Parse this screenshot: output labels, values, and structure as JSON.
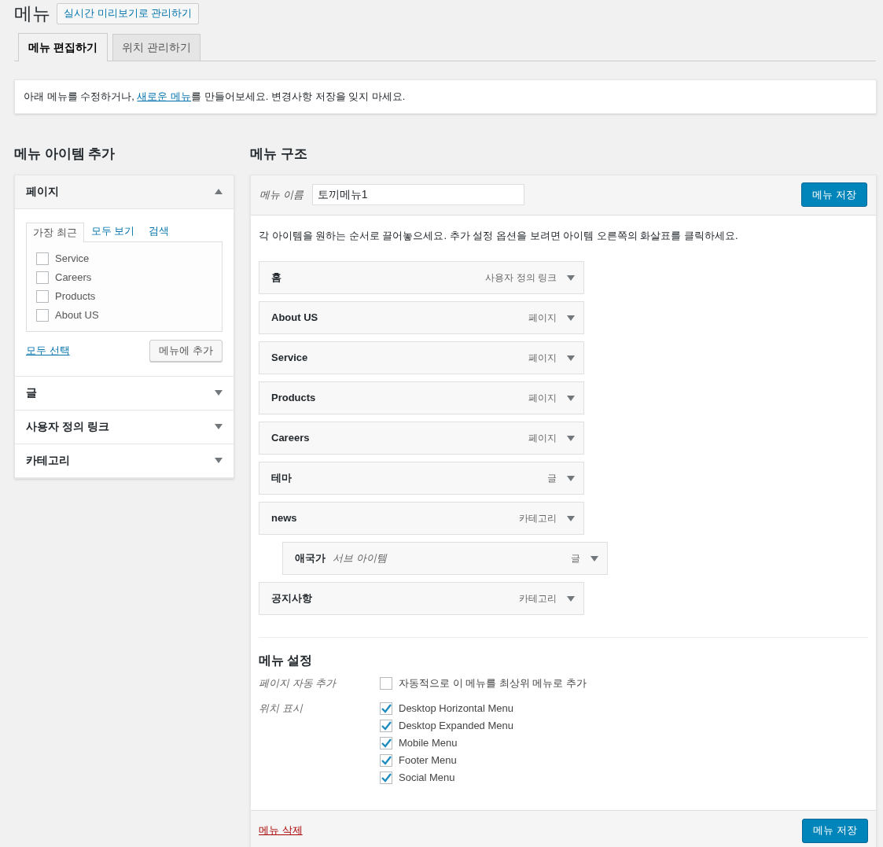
{
  "page_title": "메뉴",
  "live_preview_button": "실시간 미리보기로 관리하기",
  "tabs": [
    {
      "label": "메뉴 편집하기",
      "selected": true
    },
    {
      "label": "위치 관리하기",
      "selected": false
    }
  ],
  "notice": {
    "before": "아래 메뉴를 수정하거나, ",
    "link": "새로운 메뉴",
    "after": "를 만들어보세요. 변경사항 저장을 잊지 마세요."
  },
  "add_items": {
    "heading": "메뉴 아이템 추가",
    "sections": [
      {
        "title": "페이지",
        "expanded": true,
        "subtabs": [
          {
            "label": "가장 최근",
            "selected": true
          },
          {
            "label": "모두 보기",
            "selected": false
          },
          {
            "label": "검색",
            "selected": false
          }
        ],
        "items": [
          {
            "label": "Service",
            "checked": false
          },
          {
            "label": "Careers",
            "checked": false
          },
          {
            "label": "Products",
            "checked": false
          },
          {
            "label": "About US",
            "checked": false
          }
        ],
        "select_all": "모두 선택",
        "add_button": "메뉴에 추가"
      },
      {
        "title": "글",
        "expanded": false
      },
      {
        "title": "사용자 정의 링크",
        "expanded": false
      },
      {
        "title": "카테고리",
        "expanded": false
      }
    ]
  },
  "structure": {
    "heading": "메뉴 구조",
    "name_label": "메뉴 이름",
    "name_value": "토끼메뉴1",
    "save_button": "메뉴 저장",
    "instructions": "각 아이템을 원하는 순서로 끌어놓으세요. 추가 설정 옵션을 보려면 아이템 오른쪽의 화살표를 클릭하세요.",
    "items": [
      {
        "title": "홈",
        "type": "사용자 정의 링크"
      },
      {
        "title": "About US",
        "type": "페이지"
      },
      {
        "title": "Service",
        "type": "페이지"
      },
      {
        "title": "Products",
        "type": "페이지"
      },
      {
        "title": "Careers",
        "type": "페이지"
      },
      {
        "title": "테마",
        "type": "글"
      },
      {
        "title": "news",
        "type": "카테고리",
        "children": [
          {
            "title": "애국가",
            "subtitle": "서브 아이템",
            "type": "글"
          }
        ]
      },
      {
        "title": "공지사항",
        "type": "카테고리"
      }
    ],
    "settings": {
      "heading": "메뉴 설정",
      "rows": [
        {
          "label": "페이지 자동 추가",
          "options": [
            {
              "label": "자동적으로 이 메뉴를 최상위 메뉴로 추가",
              "checked": false
            }
          ]
        },
        {
          "label": "위치 표시",
          "options": [
            {
              "label": "Desktop Horizontal Menu",
              "checked": true
            },
            {
              "label": "Desktop Expanded Menu",
              "checked": true
            },
            {
              "label": "Mobile Menu",
              "checked": true
            },
            {
              "label": "Footer Menu",
              "checked": true
            },
            {
              "label": "Social Menu",
              "checked": true
            }
          ]
        }
      ]
    },
    "delete_link": "메뉴 삭제",
    "save_button_bottom": "메뉴 저장"
  }
}
